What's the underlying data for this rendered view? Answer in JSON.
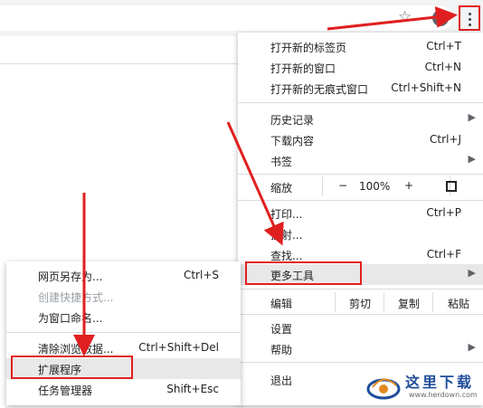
{
  "menu": {
    "items": [
      {
        "label": "打开新的标签页",
        "shortcut": "Ctrl+T"
      },
      {
        "label": "打开新的窗口",
        "shortcut": "Ctrl+N"
      },
      {
        "label": "打开新的无痕式窗口",
        "shortcut": "Ctrl+Shift+N"
      },
      {
        "label": "历史记录"
      },
      {
        "label": "下载内容",
        "shortcut": "Ctrl+J"
      },
      {
        "label": "书签"
      },
      {
        "label": "打印...",
        "shortcut": "Ctrl+P"
      },
      {
        "label": "投射..."
      },
      {
        "label": "查找...",
        "shortcut": "Ctrl+F"
      },
      {
        "label": "更多工具"
      },
      {
        "label": "设置"
      },
      {
        "label": "帮助"
      },
      {
        "label": "退出"
      }
    ],
    "zoom": {
      "label": "缩放",
      "minus": "−",
      "value": "100%",
      "plus": "+"
    },
    "edit": {
      "label": "编辑",
      "cut": "剪切",
      "copy": "复制",
      "paste": "粘贴"
    }
  },
  "submenu": {
    "items": [
      {
        "label": "网页另存为...",
        "shortcut": "Ctrl+S"
      },
      {
        "label": "创建快捷方式..."
      },
      {
        "label": "为窗口命名..."
      },
      {
        "label": "清除浏览数据...",
        "shortcut": "Ctrl+Shift+Del"
      },
      {
        "label": "扩展程序"
      },
      {
        "label": "任务管理器",
        "shortcut": "Shift+Esc"
      }
    ]
  },
  "watermark": {
    "name": "这里下载",
    "url": "www.herdown.com"
  },
  "colors": {
    "annotation": "#e02020",
    "toolbar": "#f1f3f4",
    "watermark": "#1f4e9a"
  }
}
